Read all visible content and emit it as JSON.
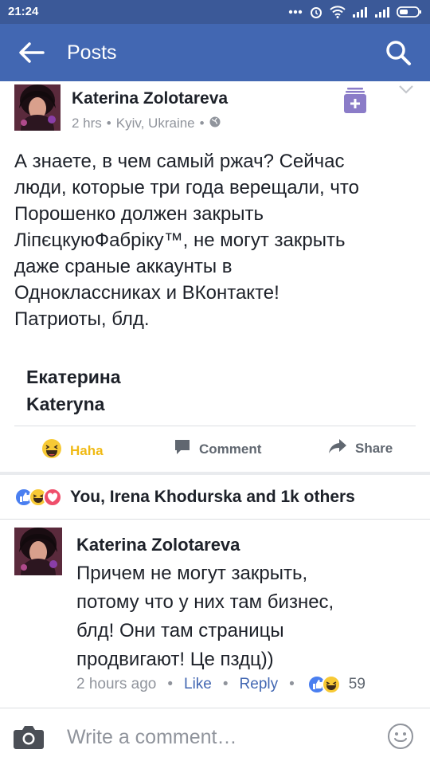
{
  "status_bar": {
    "time": "21:24"
  },
  "app_bar": {
    "title": "Posts"
  },
  "post": {
    "author": "Katerina Zolotareva",
    "time": "2 hrs",
    "location": "Kyiv, Ukraine",
    "text_lines": [
      "А знаете, в чем самый ржач? Сейчас",
      "люди, которые три года верещали, что",
      "Порошенко должен закрыть",
      "ЛіпєцкуюФабріку™, не могут закрыть",
      "даже сраные аккаунты в",
      "Одноклассниках и ВКонтакте!",
      "Патриоты, блд."
    ],
    "signature_lines": [
      "Екатерина",
      "Kateryna"
    ]
  },
  "actions": {
    "haha": "Haha",
    "comment": "Comment",
    "share": "Share"
  },
  "reactions_summary": "You, Irena Khodurska and 1k others",
  "comment": {
    "author": "Katerina Zolotareva",
    "text_lines": [
      "Причем не могут закрыть,",
      "потому что у них там бизнес,",
      "блд! Они там страницы",
      "продвигают! Це пздц))"
    ],
    "time": "2 hours ago",
    "like_label": "Like",
    "reply_label": "Reply",
    "reaction_count": "59"
  },
  "composer": {
    "placeholder": "Write a comment…"
  },
  "colors": {
    "status_bar": "#3b5998",
    "app_bar": "#4267b2",
    "link": "#4267b2",
    "haha": "#f0ba15",
    "like": "#4a7ff0",
    "love": "#ef4f6b"
  },
  "icons": [
    "back-arrow-icon",
    "search-icon",
    "globe-icon",
    "save-bookmark-icon",
    "chevron-down-icon",
    "haha-icon",
    "comment-icon",
    "share-icon",
    "like-reaction-icon",
    "love-reaction-icon",
    "camera-icon",
    "emoji-icon"
  ]
}
